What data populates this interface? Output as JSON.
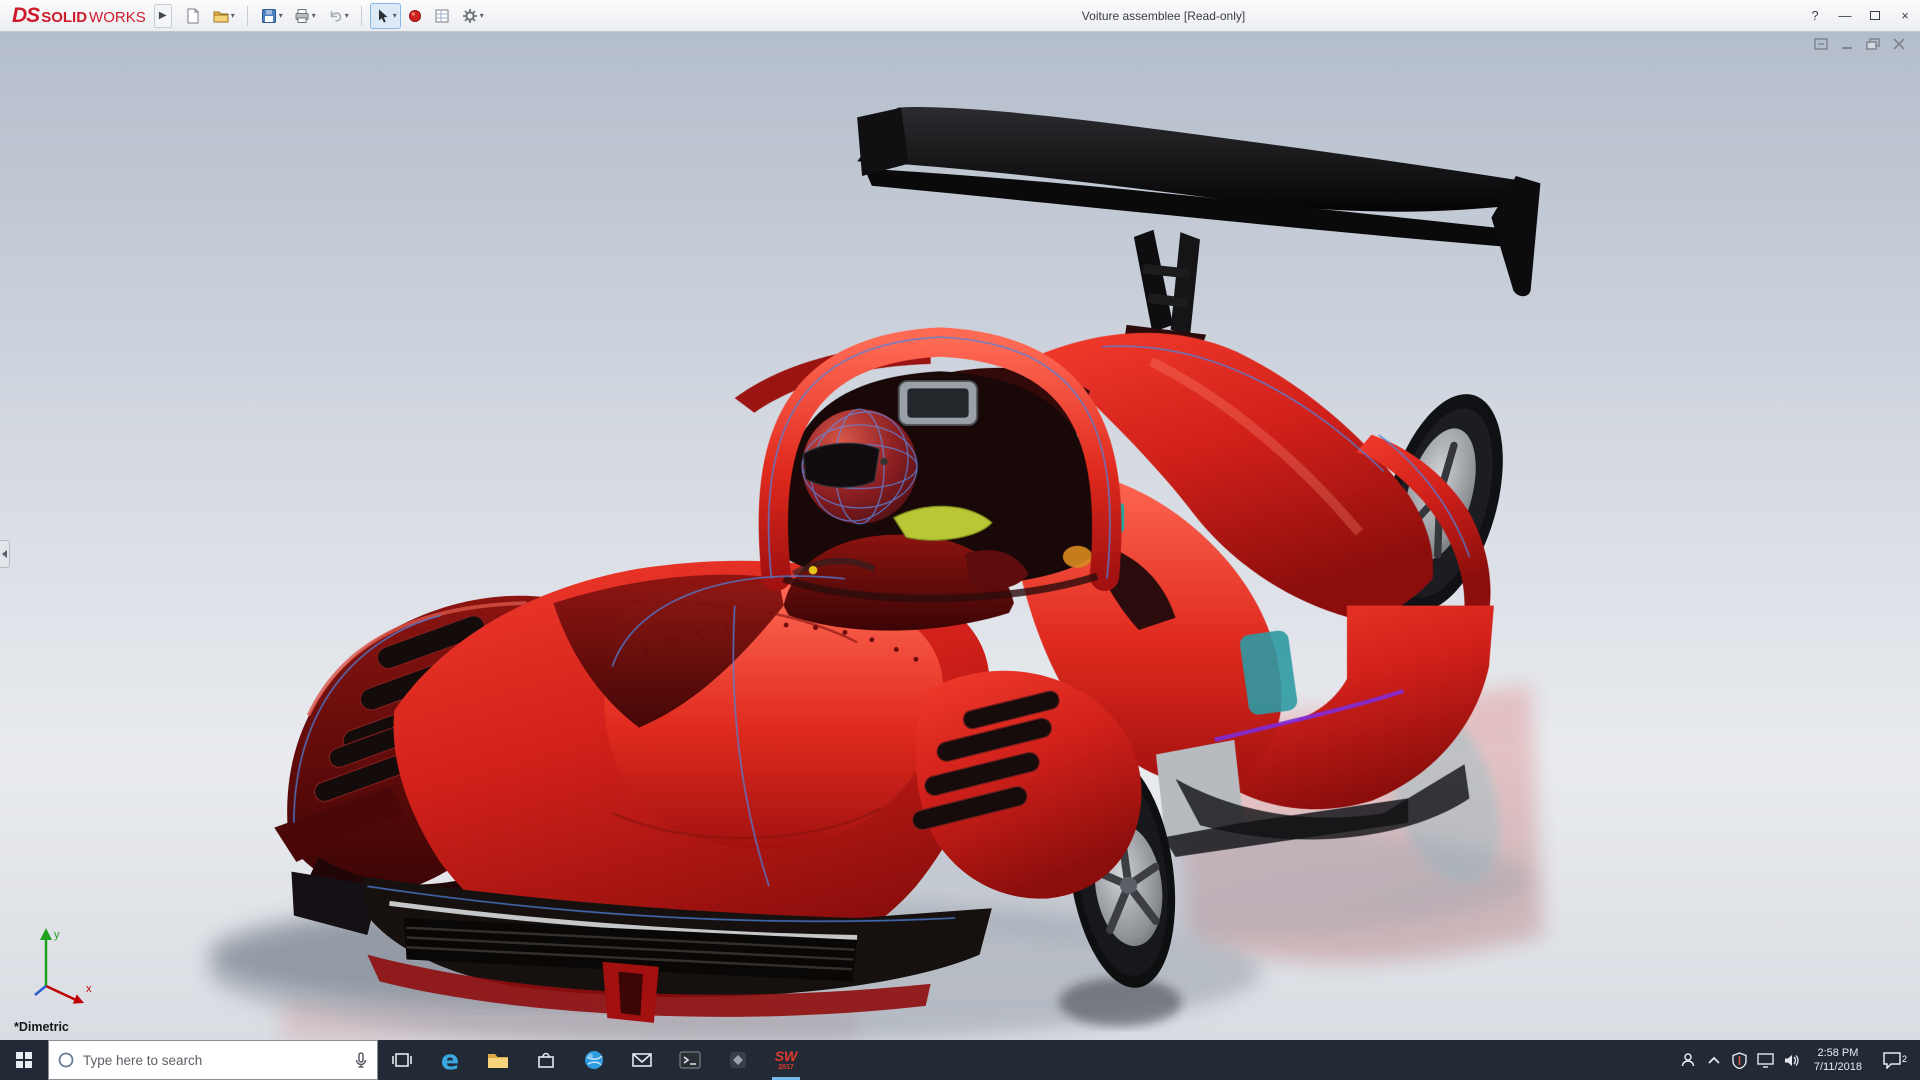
{
  "titlebar": {
    "brand": {
      "ds": "DS",
      "solid": "SOLID",
      "works": "WORKS"
    },
    "flyout_arrow": "▶",
    "caret": "▾",
    "title": "Voiture assemblee [Read-only]",
    "help_glyph": "?",
    "minimize_glyph": "—",
    "close_glyph": "×"
  },
  "viewport": {
    "orientation_label": "*Dimetric",
    "axis_x_label": "x",
    "axis_y_label": "y"
  },
  "taskbar": {
    "search_placeholder": "Type here to search",
    "edge_glyph": "e",
    "solidworks_text": "SW",
    "solidworks_year": "2017",
    "time": "2:58 PM",
    "date": "7/11/2018",
    "action_center_badge": "2"
  },
  "colors": {
    "brand_red": "#cf1a2b",
    "car_red": "#d0201a",
    "selection_blue": "#8ab4e8",
    "taskbar_bg": "#222a36",
    "viewport_top": "#b7c0cd"
  }
}
